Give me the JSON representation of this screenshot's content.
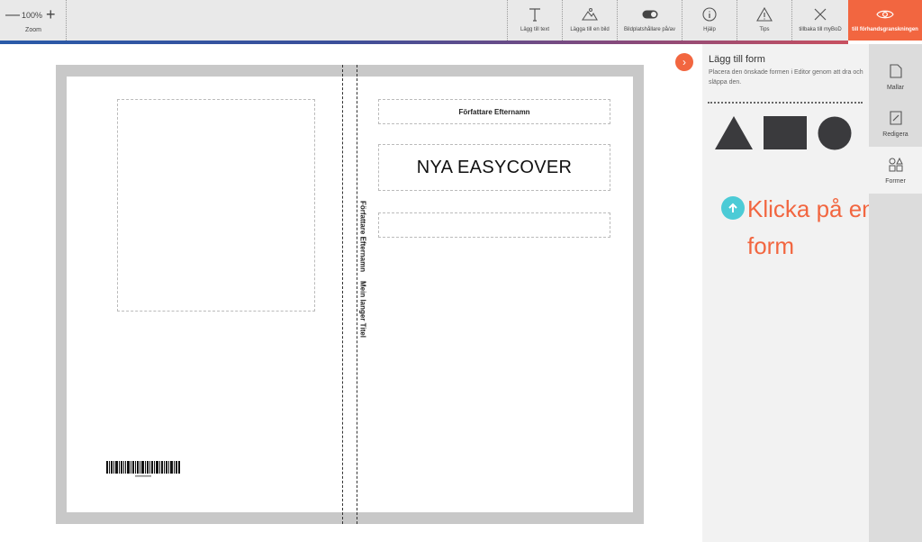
{
  "toolbar": {
    "zoom_value": "100%",
    "zoom_label": "Zoom",
    "tools": {
      "add_text": "Lägg till text",
      "add_image": "Lägga till en bild",
      "placeholder_toggle": "Bildplatshållare på/av",
      "help": "Hjälp",
      "tips": "Tips",
      "back": "tillbaka till myBoD",
      "preview": "till förhandsgranskningen"
    },
    "icons": {
      "add_text": "text-T-icon",
      "add_image": "mountain-image-icon",
      "placeholder_toggle": "toggle-switch-icon",
      "help": "info-circle-icon",
      "tips": "warning-triangle-icon",
      "back": "close-x-icon",
      "preview": "eye-icon"
    }
  },
  "cover": {
    "author": "Författare Efternamn",
    "title": "NYA EASYCOVER",
    "spine_author": "Författare Efternamn",
    "spine_title": "Mein langer Titel"
  },
  "panel": {
    "title": "Lägg till form",
    "description": "Placera den önskade formen i Editor genom att dra och släppa den.",
    "shapes": [
      "triangle",
      "rectangle",
      "circle"
    ],
    "hint": "Klicka på en form"
  },
  "tabs": [
    {
      "label": "Mallar",
      "icon": "document-icon"
    },
    {
      "label": "Redigera",
      "icon": "edit-icon"
    },
    {
      "label": "Former",
      "icon": "shapes-icon"
    }
  ],
  "colors": {
    "accent": "#f26640",
    "hint_icon": "#4ccbd6",
    "shape_fill": "#3a3a3d"
  }
}
